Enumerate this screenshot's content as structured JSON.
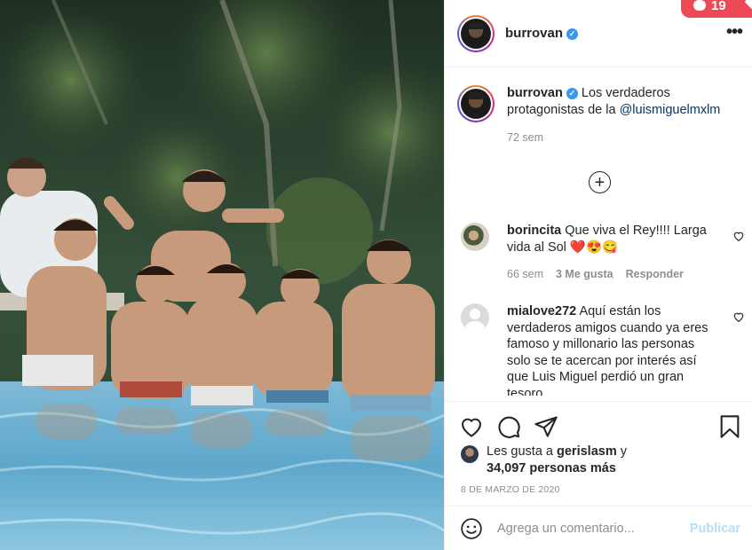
{
  "post": {
    "username": "burrovan",
    "verified_icon": "verified-badge-icon",
    "more_icon": "more-options-icon",
    "more_label": "•••",
    "accent_color": "#3897f0"
  },
  "notification": {
    "count": "19"
  },
  "caption": {
    "author": "burrovan",
    "text": "Los verdaderos protagonistas de la",
    "mention": "@luismiguelmxlm",
    "time": "72 sem"
  },
  "load_more": {
    "icon": "plus-circle-icon",
    "label": "+"
  },
  "comments": [
    {
      "user": "borincita",
      "text": "Que viva el Rey!!!! Larga vida al Sol ❤️😍😋",
      "time": "66 sem",
      "likes": "3 Me gusta",
      "reply": "Responder"
    },
    {
      "user": "mialove272",
      "text": "Aquí están los verdaderos amigos cuando ya eres famoso y millonario las personas solo se te acercan por interés así que Luis Miguel perdió un gran tesoro..."
    }
  ],
  "actions": {
    "like_icon": "heart-icon",
    "comment_icon": "comment-icon",
    "share_icon": "paper-plane-icon",
    "save_icon": "bookmark-icon"
  },
  "likes": {
    "prefix": "Les gusta a",
    "user": "gerislasm",
    "joiner": "y",
    "count": "34,097 personas más"
  },
  "date": "8 DE MARZO DE 2020",
  "add_comment": {
    "emoji_icon": "smiley-icon",
    "placeholder": "Agrega un comentario...",
    "post_label": "Publicar"
  },
  "colors": {
    "link": "#00376b",
    "muted": "#8e8e8e",
    "publish_disabled": "#b2dffc",
    "notification": "#ed4956"
  }
}
